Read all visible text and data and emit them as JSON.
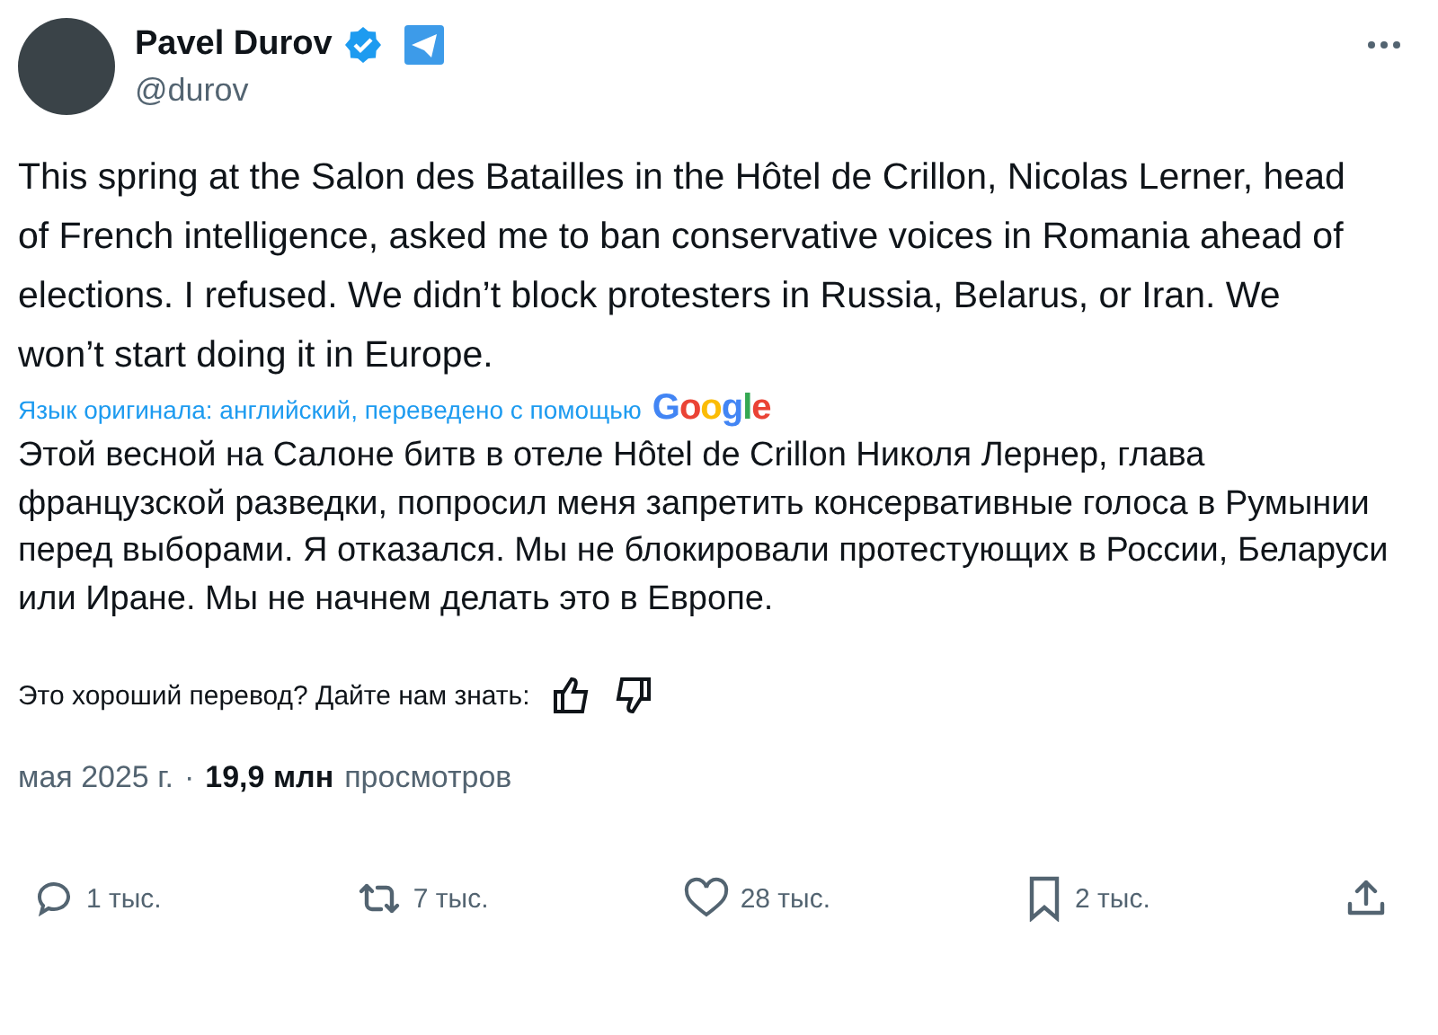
{
  "author": {
    "name": "Pavel Durov",
    "handle": "@durov",
    "verified": true
  },
  "text": "This spring at the Salon des Batailles in the Hôtel de Crillon, Nicolas Lerner, head of French intelligence, asked me to ban conservative voices in Romania ahead of elections. I refused. We didn’t block protesters in Russia, Belarus, or Iran. We won’t start doing it in Europe.",
  "translation_note": "Язык оригинала: английский, переведено с помощью",
  "translation_provider": "Google",
  "translated_text": "Этой весной на Салоне битв в отеле Hôtel de Crillon Николя Лернер, глава французской разведки, попросил меня запретить консервативные голоса в Румынии перед выборами. Я отказался. Мы не блокировали протестующих в России, Беларуси или Иране. Мы не начнем делать это в Европе.",
  "feedback_prompt": "Это хороший перевод? Дайте нам знать:",
  "timestamp": "мая 2025 г.",
  "separator": "·",
  "views_count": "19,9 млн",
  "views_label": "просмотров",
  "actions": [
    {
      "kind": "reply",
      "count": "1 тыс."
    },
    {
      "kind": "repost",
      "count": "7 тыс."
    },
    {
      "kind": "like",
      "count": "28 тыс."
    },
    {
      "kind": "bookmark",
      "count": "2 тыс."
    },
    {
      "kind": "share"
    }
  ]
}
